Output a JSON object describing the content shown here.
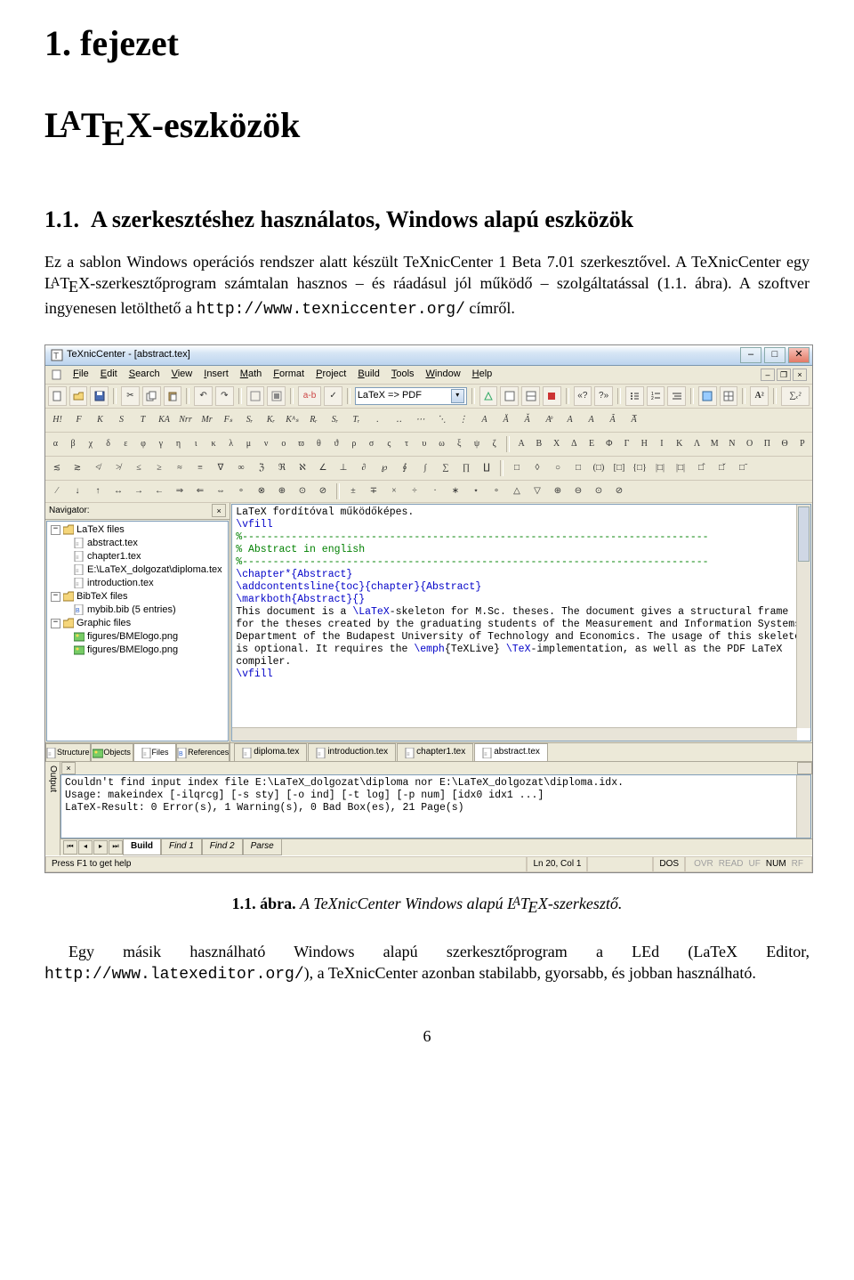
{
  "chapter_number_text": "1. fejezet",
  "chapter_title_prefix": "-eszközök",
  "section_number": "1.1.",
  "section_title": "A szerkesztéshez használatos, Windows alapú eszközök",
  "para1_a": "Ez a sablon Windows operációs rendszer alatt készült TeXnicCenter 1 Beta 7.01 szerkesztővel. A TeXnicCenter egy ",
  "para1_b": "-szerkesztőprogram számtalan hasznos – és ráadásul jól működő – szolgáltatással (1.1. ábra). A szoftver ingyenesen letölthető a ",
  "para1_url": "http://www.texniccenter.org/",
  "para1_c": " címről.",
  "caption_num": "1.1. ábra.",
  "caption_text_a": "A TeXnicCenter Windows alapú ",
  "caption_text_b": "-szerkesztő.",
  "para2_a": "Egy másik használható Windows alapú szerkesztőprogram a LEd (LaTeX Editor, ",
  "para2_url": "http://www.latexeditor.org/",
  "para2_b": "), a TeXnicCenter azonban stabilabb, gyorsabb, és jobban használható.",
  "page_number": "6",
  "shot": {
    "title": "TeXnicCenter - [abstract.tex]",
    "menus": [
      "File",
      "Edit",
      "Search",
      "View",
      "Insert",
      "Math",
      "Format",
      "Project",
      "Build",
      "Tools",
      "Window",
      "Help"
    ],
    "profile": "LaTeX => PDF",
    "nav_title": "Navigator:",
    "tree": {
      "root1": {
        "label": "LaTeX files",
        "open": true,
        "children": [
          "abstract.tex",
          "chapter1.tex",
          "E:\\LaTeX_dolgozat\\diploma.tex",
          "introduction.tex"
        ]
      },
      "root2": {
        "label": "BibTeX files",
        "open": true,
        "children": [
          "mybib.bib (5 entries)"
        ]
      },
      "root3": {
        "label": "Graphic files",
        "open": true,
        "children": [
          "figures/BMElogo.png",
          "figures/BMElogo.png"
        ]
      }
    },
    "nav_tabs": [
      "Structure",
      "Objects",
      "Files",
      "References"
    ],
    "editor_lines": [
      {
        "t": "LaTeX fordítóval működőképes.",
        "k": 0
      },
      {
        "t": "\\vfill",
        "k": 1
      },
      {
        "t": "",
        "k": 0
      },
      {
        "t": "%----------------------------------------------------------------------------",
        "k": 2
      },
      {
        "t": "% Abstract in english",
        "k": 2
      },
      {
        "t": "%----------------------------------------------------------------------------",
        "k": 2
      },
      {
        "t": "\\chapter*{Abstract}",
        "k": 1
      },
      {
        "t": "\\addcontentsline{toc}{chapter}{Abstract}",
        "k": 1
      },
      {
        "t": "\\markboth{Abstract}{}",
        "k": 1
      },
      {
        "t": "",
        "k": 0
      },
      {
        "t": "This document is a \\LaTeX-skeleton for M.Sc. theses. The document gives a structural frame",
        "k": 3
      },
      {
        "t": "for the theses created by the graduating students of the Measurement and Information Systems",
        "k": 0
      },
      {
        "t": "Department of the Budapest University of Technology and Economics. The usage of this skeleton",
        "k": 0
      },
      {
        "t": "is optional. It requires the \\emph{TeXLive} \\TeX-implementation, as well as the PDF LaTeX",
        "k": 3
      },
      {
        "t": "compiler.",
        "k": 0
      },
      {
        "t": "\\vfill",
        "k": 1
      }
    ],
    "editor_tabs": [
      "diploma.tex",
      "introduction.tex",
      "chapter1.tex",
      "abstract.tex"
    ],
    "output_lines": [
      "Couldn't find input index file E:\\LaTeX_dolgozat\\diploma nor E:\\LaTeX_dolgozat\\diploma.idx.",
      "Usage: makeindex [-ilqrcg] [-s sty] [-o ind] [-t log] [-p num] [idx0 idx1 ...]",
      "",
      "LaTeX-Result: 0 Error(s), 1 Warning(s), 0 Bad Box(es), 21 Page(s)"
    ],
    "output_side": "Output",
    "output_tabs": [
      "Build",
      "Find 1",
      "Find 2",
      "Parse"
    ],
    "status_left": "Press F1 to get help",
    "status_pos": "Ln 20, Col 1",
    "status_dos": "DOS",
    "status_flags": [
      "OVR",
      "READ",
      "UF",
      "NUM",
      "RF"
    ],
    "greek_lower": [
      "α",
      "β",
      "χ",
      "δ",
      "ε",
      "φ",
      "γ",
      "η",
      "ι",
      "κ",
      "λ",
      "μ",
      "ν",
      "o",
      "ϖ",
      "θ",
      "ϑ",
      "ρ",
      "σ",
      "ς",
      "τ",
      "υ",
      "ω",
      "ξ",
      "ψ",
      "ζ"
    ],
    "greek_upper": [
      "A",
      "B",
      "X",
      "Δ",
      "E",
      "Φ",
      "Γ",
      "H",
      "I",
      "K",
      "Λ",
      "M",
      "N",
      "O",
      "Π",
      "Θ",
      "P"
    ],
    "mathstyles": [
      "H!",
      "F",
      "K",
      "S",
      "T",
      "KA",
      "Nrr",
      "Mr",
      "Fₛ",
      "Sᵣ",
      "Kᵣ",
      "Kᴬₛ",
      "Rᵣ",
      "Sᵣ",
      "Tᵣ",
      ".",
      "‥",
      "⋯",
      "⋱",
      "⋮",
      "A",
      "Ă",
      "Ǎ",
      "Aͦ",
      "A",
      "A",
      "Ã",
      "A̅"
    ],
    "ops1": [
      "≲",
      "≳",
      "≮",
      "≯",
      "≤",
      "≥",
      "≈",
      "≡",
      "∇",
      "∞",
      "ℨ",
      "ℜ",
      "ℵ",
      "∠",
      "⊥",
      "∂",
      "℘",
      "∮",
      "∫",
      "∑",
      "∏",
      "∐"
    ],
    "ops2": [
      "□",
      "◊",
      "○",
      "□",
      "(□)",
      "[□]",
      "{□}",
      "|□|",
      "|□|",
      "□̂",
      "□̌",
      "□̃"
    ],
    "ops3": [
      "⁄",
      "↓",
      "↑",
      "↔",
      "→",
      "←",
      "⇒",
      "⇐",
      "⇔",
      "∘",
      "⊗",
      "⊕",
      "⊙",
      "⊘"
    ],
    "ops4": [
      "±",
      "∓",
      "×",
      "÷",
      "·",
      "∗",
      "⋆",
      "∘",
      "△",
      "▽",
      "⊕",
      "⊖",
      "⊙",
      "⊘"
    ]
  }
}
